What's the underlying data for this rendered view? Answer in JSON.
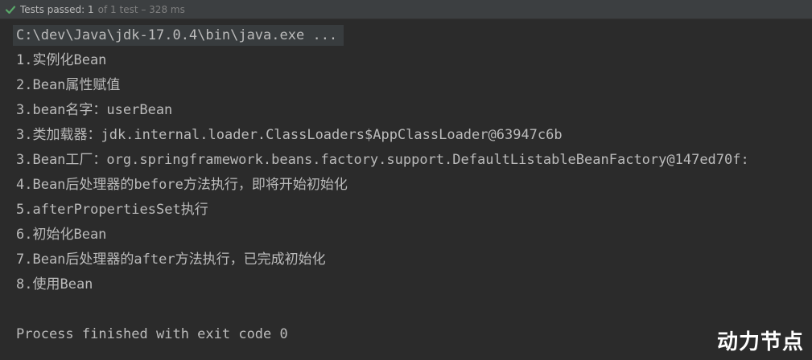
{
  "test_status": {
    "label": "Tests passed: 1",
    "meta": "of 1 test – 328 ms",
    "icon": "check-icon",
    "icon_color": "#59a869"
  },
  "console": {
    "command": "C:\\dev\\Java\\jdk-17.0.4\\bin\\java.exe ...",
    "lines": [
      "1.实例化Bean",
      "2.Bean属性赋值",
      "3.bean名字：userBean",
      "3.类加载器：jdk.internal.loader.ClassLoaders$AppClassLoader@63947c6b",
      "3.Bean工厂：org.springframework.beans.factory.support.DefaultListableBeanFactory@147ed70f:",
      "4.Bean后处理器的before方法执行，即将开始初始化",
      "5.afterPropertiesSet执行",
      "6.初始化Bean",
      "7.Bean后处理器的after方法执行，已完成初始化",
      "8.使用Bean",
      "",
      "Process finished with exit code 0"
    ]
  },
  "watermark": "动力节点",
  "colors": {
    "background": "#2b2b2b",
    "text": "#bbbbbb",
    "status_bar": "#3c3f41"
  }
}
